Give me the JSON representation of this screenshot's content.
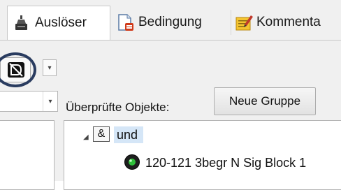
{
  "tabs": [
    {
      "label": "Auslöser",
      "icon": "trigger-icon",
      "active": true
    },
    {
      "label": "Bedingung",
      "icon": "condition-icon",
      "active": false
    },
    {
      "label": "Kommenta",
      "icon": "comment-icon",
      "active": false
    }
  ],
  "toolbar": {
    "logic_icon": "logic-gate-icon",
    "dropdown_arrow": "▾"
  },
  "filter_combo": {
    "value": "",
    "arrow": "▾"
  },
  "checked_objects": {
    "label": "Überprüfte Objekte:",
    "new_group_button": "Neue Gruppe"
  },
  "tree": {
    "expander": "◢",
    "group": {
      "operator_symbol": "&",
      "label": "und"
    },
    "items": [
      {
        "label": "120-121 3begr N Sig Block 1",
        "icon": "signal-icon"
      }
    ]
  },
  "colors": {
    "highlight_ring": "#2a3c60",
    "selection": "#d5e6f7",
    "signal_green": "#2fbf3a"
  }
}
